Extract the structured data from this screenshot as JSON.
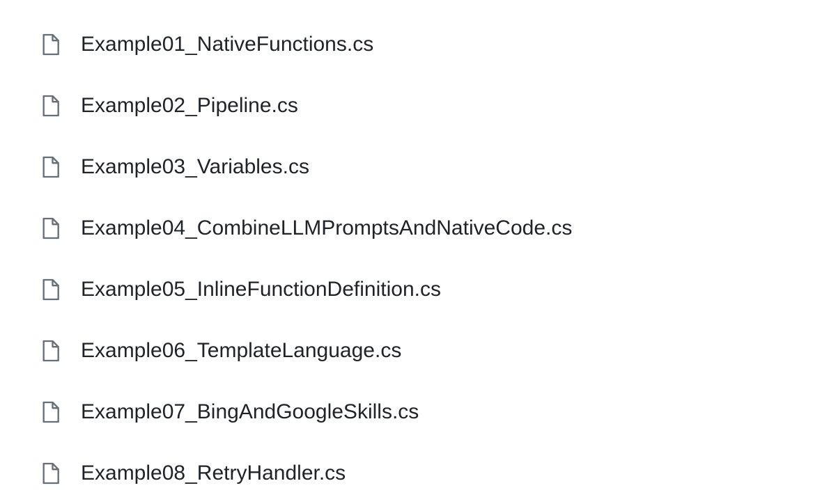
{
  "files": [
    {
      "name": "Example01_NativeFunctions.cs"
    },
    {
      "name": "Example02_Pipeline.cs"
    },
    {
      "name": "Example03_Variables.cs"
    },
    {
      "name": "Example04_CombineLLMPromptsAndNativeCode.cs"
    },
    {
      "name": "Example05_InlineFunctionDefinition.cs"
    },
    {
      "name": "Example06_TemplateLanguage.cs"
    },
    {
      "name": "Example07_BingAndGoogleSkills.cs"
    },
    {
      "name": "Example08_RetryHandler.cs"
    }
  ]
}
